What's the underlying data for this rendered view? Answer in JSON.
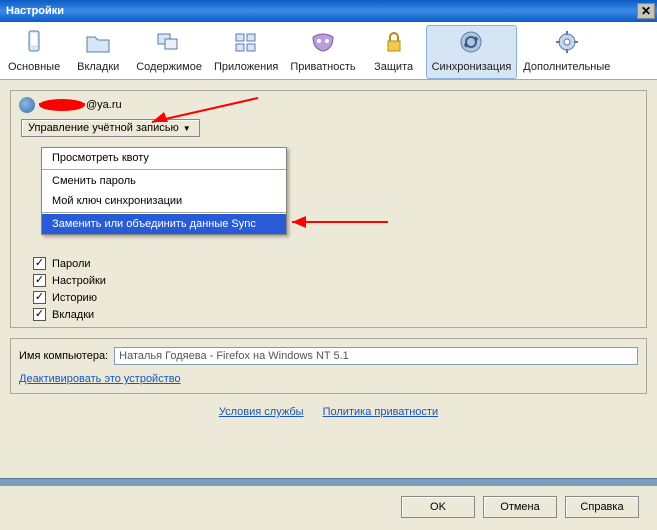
{
  "window": {
    "title": "Настройки"
  },
  "toolbar": {
    "items": [
      {
        "label": "Основные"
      },
      {
        "label": "Вкладки"
      },
      {
        "label": "Содержимое"
      },
      {
        "label": "Приложения"
      },
      {
        "label": "Приватность"
      },
      {
        "label": "Защита"
      },
      {
        "label": "Синхронизация"
      },
      {
        "label": "Дополнительные"
      }
    ]
  },
  "user": {
    "domain": "@ya.ru"
  },
  "account_button": {
    "label": "Управление учётной записью"
  },
  "dropdown": {
    "items": [
      {
        "label": "Просмотреть квоту"
      },
      {
        "label": "Сменить пароль"
      },
      {
        "label": "Мой ключ синхронизации"
      },
      {
        "label": "Заменить или объединить данные Sync"
      }
    ]
  },
  "checks": [
    {
      "label": "Пароли"
    },
    {
      "label": "Настройки"
    },
    {
      "label": "Историю"
    },
    {
      "label": "Вкладки"
    }
  ],
  "computer": {
    "label": "Имя компьютера:",
    "value": "Наталья Годяева - Firefox на Windows NT 5.1",
    "deactivate": "Деактивировать это устройство"
  },
  "footer_links": {
    "terms": "Условия службы",
    "privacy": "Политика приватности"
  },
  "buttons": {
    "ok": "OK",
    "cancel": "Отмена",
    "help": "Справка"
  }
}
